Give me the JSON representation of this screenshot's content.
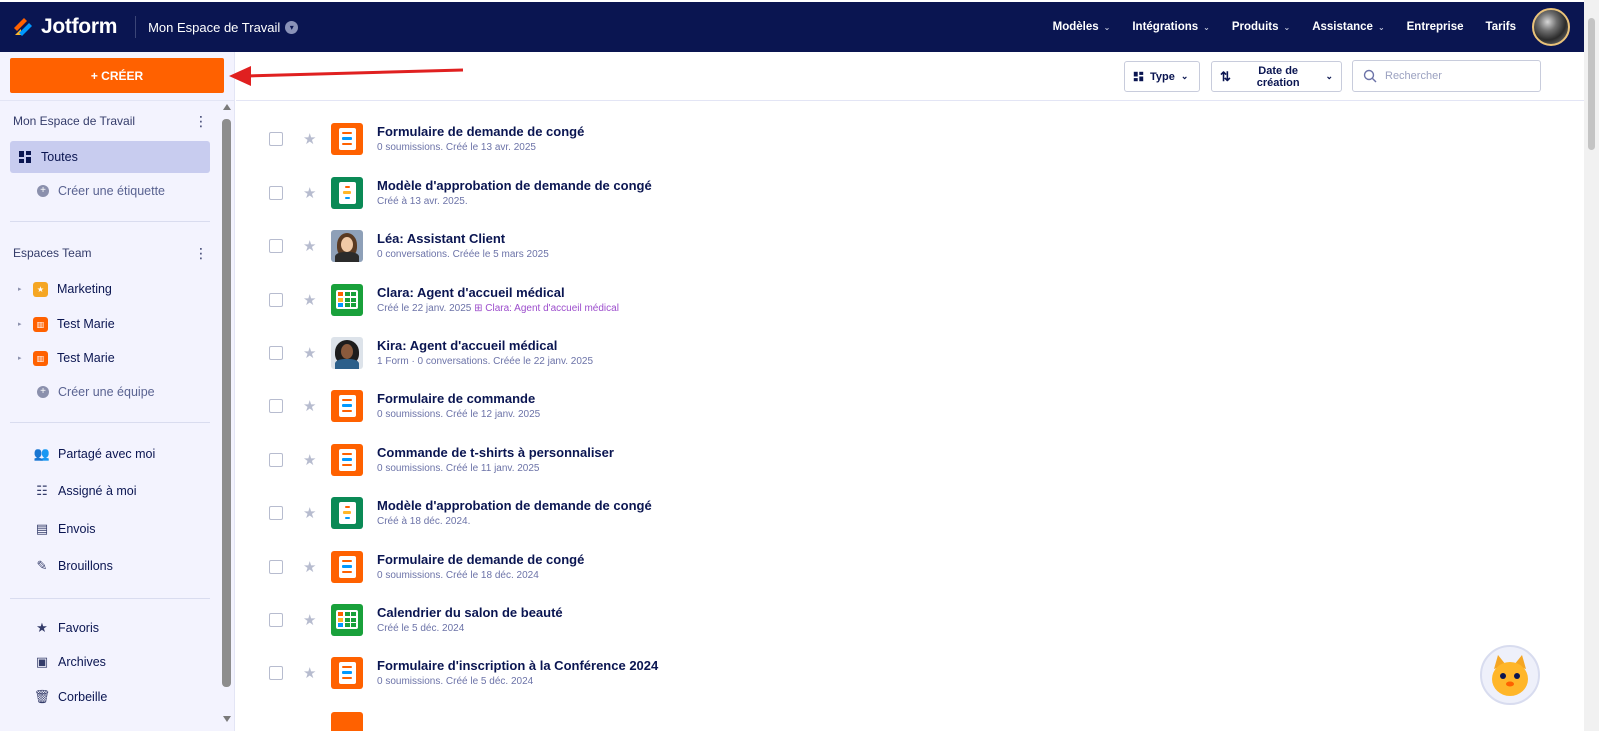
{
  "brand": {
    "name": "Jotform",
    "workspace_title": "Mon Espace de Travail"
  },
  "nav": {
    "items": [
      {
        "label": "Modèles",
        "dropdown": true
      },
      {
        "label": "Intégrations",
        "dropdown": true
      },
      {
        "label": "Produits",
        "dropdown": true
      },
      {
        "label": "Assistance",
        "dropdown": true
      },
      {
        "label": "Entreprise",
        "dropdown": false
      },
      {
        "label": "Tarifs",
        "dropdown": false
      }
    ]
  },
  "sidebar": {
    "create_label": "+ CRÉER",
    "workspace_section": "Mon Espace de Travail",
    "all_label": "Toutes",
    "create_tag_label": "Créer une étiquette",
    "teams_section": "Espaces Team",
    "teams": [
      {
        "label": "Marketing",
        "color": "#f5a623"
      },
      {
        "label": "Test Marie",
        "color": "#ff6100"
      },
      {
        "label": "Test Marie",
        "color": "#ff6100"
      }
    ],
    "create_team_label": "Créer une équipe",
    "shared_items": [
      {
        "label": "Partagé avec moi",
        "icon": "shared-users-icon"
      },
      {
        "label": "Assigné à moi",
        "icon": "assigned-list-icon"
      },
      {
        "label": "Envois",
        "icon": "submissions-icon"
      },
      {
        "label": "Brouillons",
        "icon": "drafts-icon"
      }
    ],
    "bottom_items": [
      {
        "label": "Favoris",
        "icon": "star-icon"
      },
      {
        "label": "Archives",
        "icon": "archive-icon"
      },
      {
        "label": "Corbeille",
        "icon": "trash-icon"
      }
    ]
  },
  "toolbar": {
    "type_label": "Type",
    "sort_label": "Date de création",
    "search_placeholder": "Rechercher"
  },
  "colors": {
    "navy": "#0a1551",
    "accent_orange": "#ff6100",
    "annotation_red": "#e02020",
    "tag_purple": "#9c4dcc"
  },
  "list": [
    {
      "title": "Formulaire de demande de congé",
      "sub": "0 soumissions. Créé le 13 avr. 2025",
      "kind": "form"
    },
    {
      "title": "Modèle d'approbation de demande de congé",
      "sub": "Créé à 13 avr. 2025.",
      "kind": "approval"
    },
    {
      "title": "Léa: Assistant Client",
      "sub": "0 conversations. Créée le 5 mars 2025",
      "kind": "agent-lea"
    },
    {
      "title": "Clara: Agent d'accueil médical",
      "sub": "Créé le 22 janv. 2025",
      "tag": "Clara: Agent d'accueil médical",
      "kind": "table"
    },
    {
      "title": "Kira: Agent d'accueil médical",
      "sub": "1 Form · 0 conversations. Créée le 22 janv. 2025",
      "kind": "agent-kira"
    },
    {
      "title": "Formulaire de commande",
      "sub": "0 soumissions. Créé le 12 janv. 2025",
      "kind": "form"
    },
    {
      "title": "Commande de t-shirts à personnaliser",
      "sub": "0 soumissions. Créé le 11 janv. 2025",
      "kind": "form"
    },
    {
      "title": "Modèle d'approbation de demande de congé",
      "sub": "Créé à 18 déc. 2024.",
      "kind": "approval"
    },
    {
      "title": "Formulaire de demande de congé",
      "sub": "0 soumissions. Créé le 18 déc. 2024",
      "kind": "form"
    },
    {
      "title": "Calendrier du salon de beauté",
      "sub": "Créé le 5 déc. 2024",
      "kind": "calendar"
    },
    {
      "title": "Formulaire d'inscription à la Conférence 2024",
      "sub": "0 soumissions. Créé le 5 déc. 2024",
      "kind": "form"
    }
  ]
}
